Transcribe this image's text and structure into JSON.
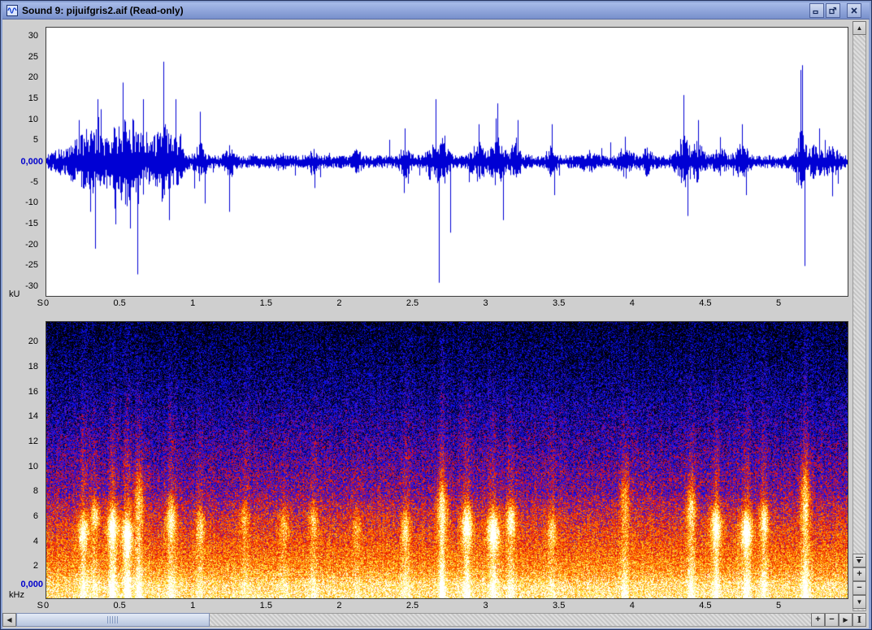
{
  "window": {
    "title": "Sound 9: pijuifgris2.aif (Read-only)"
  },
  "waveform": {
    "y_unit": "kU",
    "x_unit": "S",
    "zero_label": "0,000",
    "y_tick_labels": [
      "30",
      "25",
      "20",
      "15",
      "10",
      "5",
      "-5",
      "-10",
      "-15",
      "-20",
      "-25",
      "-30"
    ],
    "x_tick_labels": [
      "0",
      "0.5",
      "1",
      "1.5",
      "2",
      "2.5",
      "3",
      "3.5",
      "4",
      "4.5",
      "5"
    ]
  },
  "spectrogram": {
    "y_unit": "kHz",
    "x_unit": "S",
    "zero_label": "0,000",
    "y_tick_labels": [
      "20",
      "18",
      "16",
      "14",
      "12",
      "10",
      "8",
      "6",
      "4",
      "2"
    ],
    "x_tick_labels": [
      "0",
      "0.5",
      "1",
      "1.5",
      "2",
      "2.5",
      "3",
      "3.5",
      "4",
      "4.5",
      "5"
    ]
  },
  "icons": {
    "plus": "+",
    "minus": "−",
    "up_arrow": "▲",
    "down_arrow": "▼",
    "left_arrow": "◀",
    "right_arrow": "▶",
    "fit": "I"
  },
  "colors": {
    "waveform_blue": "#0000d4",
    "zero_label_blue": "#0000cc",
    "titlebar_top": "#a8bbe9",
    "titlebar_bottom": "#7890cc"
  },
  "chart_data": [
    {
      "type": "line",
      "subtype": "waveform-oscillogram",
      "title": "Waveform of pijuifgris2.aif",
      "xlabel": "S",
      "ylabel": "kU",
      "x_range": [
        0,
        5.47
      ],
      "y_range": [
        -30,
        30
      ],
      "x_ticks": [
        0,
        0.5,
        1,
        1.5,
        2,
        2.5,
        3,
        3.5,
        4,
        4.5,
        5
      ],
      "y_ticks": [
        30,
        25,
        20,
        15,
        10,
        5,
        0,
        -5,
        -10,
        -15,
        -20,
        -25,
        -30
      ],
      "line_color": "#0000d4",
      "noise_floor": 1.6,
      "bursts": [
        {
          "t": 0.08,
          "w": 0.05,
          "a": 1.5
        },
        {
          "t": 0.22,
          "w": 0.08,
          "a": 5
        },
        {
          "t": 0.32,
          "w": 0.06,
          "a": 5.5
        },
        {
          "t": 0.45,
          "w": 0.09,
          "a": 6.5
        },
        {
          "t": 0.55,
          "w": 0.05,
          "a": 7
        },
        {
          "t": 0.62,
          "w": 0.04,
          "a": 8
        },
        {
          "t": 0.72,
          "w": 0.05,
          "a": 5
        },
        {
          "t": 0.8,
          "w": 0.04,
          "a": 8
        },
        {
          "t": 0.88,
          "w": 0.05,
          "a": 5
        },
        {
          "t": 1.05,
          "w": 0.04,
          "a": 3.5
        },
        {
          "t": 1.25,
          "w": 0.03,
          "a": 3
        },
        {
          "t": 1.6,
          "w": 0.03,
          "a": 1.5
        },
        {
          "t": 1.82,
          "w": 0.03,
          "a": 2
        },
        {
          "t": 2.12,
          "w": 0.03,
          "a": 1.5
        },
        {
          "t": 2.45,
          "w": 0.04,
          "a": 2.5
        },
        {
          "t": 2.62,
          "w": 0.03,
          "a": 3
        },
        {
          "t": 2.7,
          "w": 0.04,
          "a": 6
        },
        {
          "t": 2.95,
          "w": 0.05,
          "a": 3.5
        },
        {
          "t": 3.08,
          "w": 0.05,
          "a": 4.5
        },
        {
          "t": 3.2,
          "w": 0.04,
          "a": 3.5
        },
        {
          "t": 3.45,
          "w": 0.03,
          "a": 2.5
        },
        {
          "t": 3.7,
          "w": 0.04,
          "a": 1.5
        },
        {
          "t": 3.95,
          "w": 0.05,
          "a": 2.5
        },
        {
          "t": 4.1,
          "w": 0.04,
          "a": 2
        },
        {
          "t": 4.35,
          "w": 0.05,
          "a": 5
        },
        {
          "t": 4.45,
          "w": 0.04,
          "a": 3.5
        },
        {
          "t": 4.6,
          "w": 0.04,
          "a": 2.5
        },
        {
          "t": 4.75,
          "w": 0.05,
          "a": 3
        },
        {
          "t": 5.15,
          "w": 0.04,
          "a": 6
        },
        {
          "t": 5.25,
          "w": 0.04,
          "a": 3
        },
        {
          "t": 5.35,
          "w": 0.06,
          "a": 2.5
        }
      ],
      "spikes": [
        {
          "t": 0.22,
          "v": 10
        },
        {
          "t": 0.3,
          "v": -12
        },
        {
          "t": 0.35,
          "v": 15
        },
        {
          "t": 0.47,
          "v": -15
        },
        {
          "t": 0.52,
          "v": 19
        },
        {
          "t": 0.57,
          "v": -16
        },
        {
          "t": 0.62,
          "v": -27
        },
        {
          "t": 0.66,
          "v": 15
        },
        {
          "t": 0.8,
          "v": 24
        },
        {
          "t": 0.84,
          "v": -14
        },
        {
          "t": 0.88,
          "v": 15
        },
        {
          "t": 1.05,
          "v": 12
        },
        {
          "t": 1.08,
          "v": -10
        },
        {
          "t": 1.25,
          "v": -12
        },
        {
          "t": 2.45,
          "v": 8
        },
        {
          "t": 2.66,
          "v": 15
        },
        {
          "t": 2.68,
          "v": -29
        },
        {
          "t": 2.76,
          "v": -17
        },
        {
          "t": 2.95,
          "v": 9
        },
        {
          "t": 3.08,
          "v": 14
        },
        {
          "t": 3.12,
          "v": -14
        },
        {
          "t": 3.22,
          "v": 10
        },
        {
          "t": 3.45,
          "v": 9
        },
        {
          "t": 3.47,
          "v": -8
        },
        {
          "t": 3.95,
          "v": 6
        },
        {
          "t": 4.35,
          "v": 16
        },
        {
          "t": 4.38,
          "v": -13
        },
        {
          "t": 4.45,
          "v": 10
        },
        {
          "t": 4.75,
          "v": 9
        },
        {
          "t": 4.78,
          "v": -8
        },
        {
          "t": 5.15,
          "v": 22
        },
        {
          "t": 5.18,
          "v": -25
        },
        {
          "t": 5.28,
          "v": 8
        }
      ]
    },
    {
      "type": "heatmap",
      "subtype": "spectrogram",
      "title": "Spectrogram of pijuifgris2.aif",
      "xlabel": "S",
      "ylabel": "kHz",
      "x_range": [
        0,
        5.47
      ],
      "y_range": [
        0,
        21.7
      ],
      "noise_spread": 0.44,
      "colormap_stops": [
        [
          0,
          "#000000"
        ],
        [
          0.12,
          "#000048"
        ],
        [
          0.24,
          "#0010ff"
        ],
        [
          0.38,
          "#5a18c0"
        ],
        [
          0.44,
          "#c00040"
        ],
        [
          0.5,
          "#e81800"
        ],
        [
          0.62,
          "#ff5500"
        ],
        [
          0.74,
          "#ff9900"
        ],
        [
          0.86,
          "#ffee44"
        ],
        [
          1,
          "#ffffff"
        ]
      ],
      "base_profile": [
        [
          0,
          0.92
        ],
        [
          0.6,
          0.9
        ],
        [
          1.2,
          0.8
        ],
        [
          2,
          0.72
        ],
        [
          3,
          0.66
        ],
        [
          4,
          0.61
        ],
        [
          5,
          0.57
        ],
        [
          6,
          0.52
        ],
        [
          7,
          0.46
        ],
        [
          8,
          0.39
        ],
        [
          10,
          0.34
        ],
        [
          12,
          0.28
        ],
        [
          14,
          0.22
        ],
        [
          16,
          0.16
        ],
        [
          18,
          0.11
        ],
        [
          20,
          0.07
        ],
        [
          21.7,
          0.03
        ]
      ],
      "calls": [
        {
          "t": 0.25,
          "f": 4.8,
          "a": 0.4,
          "w": 0.035,
          "fw": 1.2,
          "s": 0.2
        },
        {
          "t": 0.33,
          "f": 6.2,
          "a": 0.38,
          "w": 0.03,
          "fw": 1.1,
          "s": 0.15
        },
        {
          "t": 0.45,
          "f": 5.2,
          "a": 0.45,
          "w": 0.04,
          "fw": 1.5,
          "s": 0.3
        },
        {
          "t": 0.55,
          "f": 4.6,
          "a": 0.45,
          "w": 0.04,
          "fw": 1.4,
          "s": 0.3
        },
        {
          "t": 0.63,
          "f": 7.5,
          "a": 0.3,
          "w": 0.035,
          "fw": 2.2,
          "s": 0.25
        },
        {
          "t": 0.85,
          "f": 5.8,
          "a": 0.4,
          "w": 0.035,
          "fw": 1.6,
          "s": 0.18
        },
        {
          "t": 1.05,
          "f": 5.2,
          "a": 0.28,
          "w": 0.03,
          "fw": 1.3,
          "s": 0.12
        },
        {
          "t": 1.35,
          "f": 5.8,
          "a": 0.22,
          "w": 0.03,
          "fw": 1.2,
          "s": 0.1
        },
        {
          "t": 1.62,
          "f": 5.4,
          "a": 0.22,
          "w": 0.03,
          "fw": 1.2,
          "s": 0.1
        },
        {
          "t": 1.82,
          "f": 5.8,
          "a": 0.25,
          "w": 0.03,
          "fw": 1.2,
          "s": 0.12
        },
        {
          "t": 2.12,
          "f": 5.2,
          "a": 0.18,
          "w": 0.03,
          "fw": 1.2,
          "s": 0.08
        },
        {
          "t": 2.45,
          "f": 5.0,
          "a": 0.28,
          "w": 0.03,
          "fw": 1.3,
          "s": 0.14
        },
        {
          "t": 2.7,
          "f": 6.8,
          "a": 0.35,
          "w": 0.04,
          "fw": 2.2,
          "s": 0.3
        },
        {
          "t": 2.87,
          "f": 5.4,
          "a": 0.45,
          "w": 0.04,
          "fw": 1.5,
          "s": 0.25
        },
        {
          "t": 3.05,
          "f": 4.9,
          "a": 0.48,
          "w": 0.045,
          "fw": 1.5,
          "s": 0.25
        },
        {
          "t": 3.17,
          "f": 5.8,
          "a": 0.42,
          "w": 0.035,
          "fw": 1.3,
          "s": 0.2
        },
        {
          "t": 3.45,
          "f": 5.0,
          "a": 0.28,
          "w": 0.03,
          "fw": 1.2,
          "s": 0.12
        },
        {
          "t": 3.95,
          "f": 7.5,
          "a": 0.25,
          "w": 0.035,
          "fw": 2.0,
          "s": 0.18
        },
        {
          "t": 4.4,
          "f": 6.8,
          "a": 0.3,
          "w": 0.035,
          "fw": 2.0,
          "s": 0.22
        },
        {
          "t": 4.57,
          "f": 5.3,
          "a": 0.45,
          "w": 0.04,
          "fw": 1.5,
          "s": 0.25
        },
        {
          "t": 4.78,
          "f": 4.9,
          "a": 0.48,
          "w": 0.045,
          "fw": 1.5,
          "s": 0.25
        },
        {
          "t": 4.9,
          "f": 5.8,
          "a": 0.4,
          "w": 0.03,
          "fw": 1.3,
          "s": 0.2
        },
        {
          "t": 5.18,
          "f": 7.5,
          "a": 0.32,
          "w": 0.035,
          "fw": 2.5,
          "s": 0.28
        }
      ]
    }
  ]
}
